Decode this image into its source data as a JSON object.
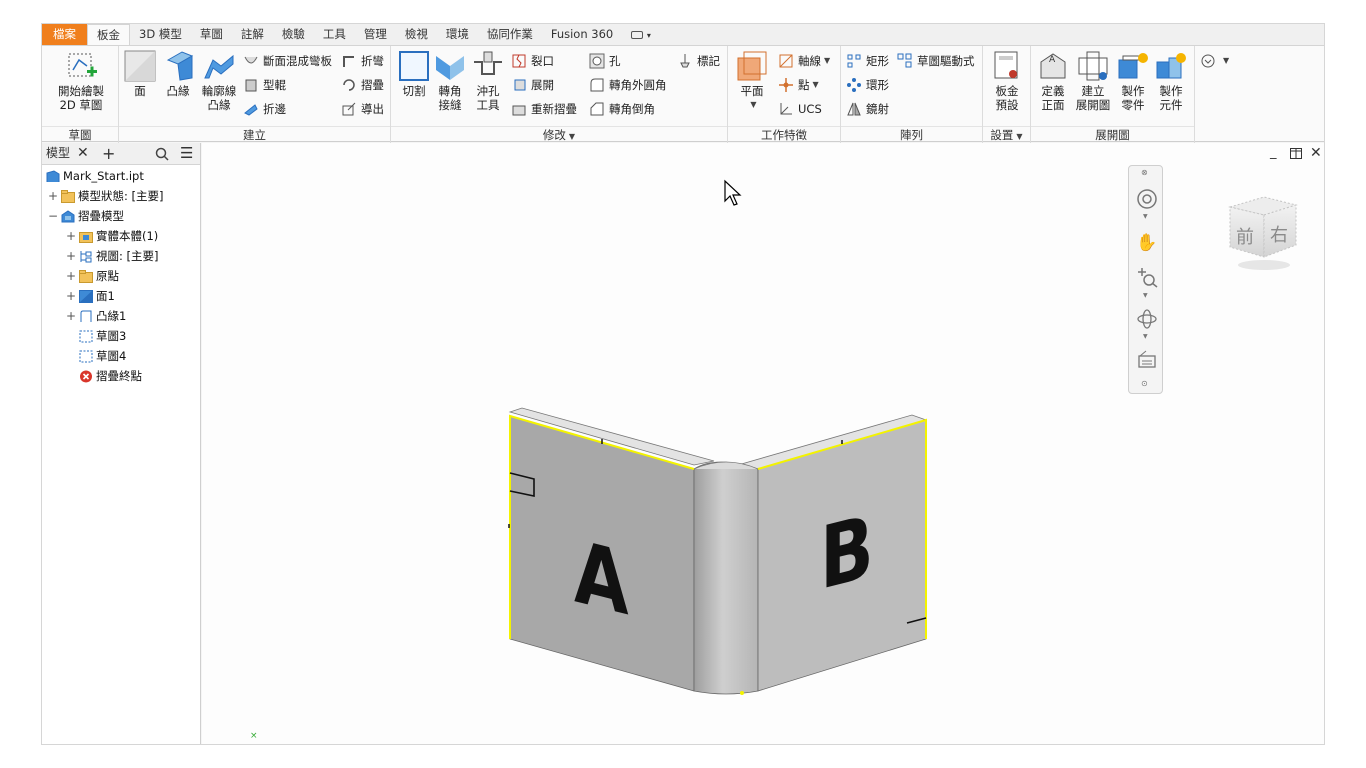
{
  "tabs": [
    "檔案",
    "板金",
    "3D 模型",
    "草圖",
    "註解",
    "檢驗",
    "工具",
    "管理",
    "檢視",
    "環境",
    "協同作業",
    "Fusion 360"
  ],
  "active_tab": "板金",
  "tab_extra_caret": "▾",
  "ribbon": {
    "sketch_panel": {
      "title": "草圖",
      "start_sketch": "開始繪製\n2D 草圖"
    },
    "create_panel": {
      "title": "建立",
      "face": "面",
      "flange": "凸緣",
      "contour_flange": "輪廓線\n凸緣",
      "lofted_flange": "斷面混成彎板",
      "contour_roll": "型輥",
      "hem": "折邊",
      "fold": "折彎",
      "unfold_ref": "摺疊",
      "export": "導出"
    },
    "modify_panel": {
      "title": "修改",
      "cut": "切割",
      "corner_seam": "轉角\n接縫",
      "punch_tool": "沖孔\n工具",
      "rip": "裂口",
      "unfold": "展開",
      "refold": "重新摺疊",
      "hole": "孔",
      "corner_round": "轉角外圓角",
      "corner_chamfer": "轉角倒角",
      "mark": "標記"
    },
    "work_features_panel": {
      "title": "工作特徵",
      "plane": "平面",
      "axis": "軸線",
      "point": "點",
      "ucs": "UCS"
    },
    "pattern_panel": {
      "title": "陣列",
      "rectangular": "矩形",
      "circular": "環形",
      "mirror": "鏡射",
      "sketch_driven": "草圖驅動式"
    },
    "setup_panel": {
      "title": "設置",
      "sheet_metal_defaults": "板金\n預設"
    },
    "flat_pattern_panel": {
      "title": "展開圖",
      "define_a_side": "定義\n正面",
      "create_flat_pattern": "建立\n展開圖",
      "make_part": "製作\n零件",
      "make_components": "製作\n元件"
    }
  },
  "browser": {
    "tab_label": "模型",
    "tree": [
      {
        "label": "Mark_Start.ipt",
        "level": 0,
        "expander": "",
        "icon": "part-icon"
      },
      {
        "label": "模型狀態: [主要]",
        "level": 1,
        "expander": "+",
        "icon": "folder-icon"
      },
      {
        "label": "摺疊模型",
        "level": 1,
        "expander": "−",
        "icon": "folded-model-icon"
      },
      {
        "label": "實體本體(1)",
        "level": 2,
        "expander": "+",
        "icon": "solid-bodies-icon"
      },
      {
        "label": "視圖: [主要]",
        "level": 2,
        "expander": "+",
        "icon": "view-icon"
      },
      {
        "label": "原點",
        "level": 2,
        "expander": "+",
        "icon": "folder-icon"
      },
      {
        "label": "面1",
        "level": 2,
        "expander": "+",
        "icon": "face-icon"
      },
      {
        "label": "凸緣1",
        "level": 2,
        "expander": "+",
        "icon": "flange-icon"
      },
      {
        "label": "草圖3",
        "level": 2,
        "expander": "",
        "icon": "sketch-icon"
      },
      {
        "label": "草圖4",
        "level": 2,
        "expander": "",
        "icon": "sketch-icon"
      },
      {
        "label": "摺疊終點",
        "level": 2,
        "expander": "",
        "icon": "end-of-folded-icon"
      }
    ]
  },
  "viewcube": {
    "front": "前",
    "right": "右"
  },
  "model": {
    "face_a_text": "A",
    "face_b_text": "B"
  },
  "colors": {
    "file_tab": "#f07f1d",
    "selection_edge": "#f3f300",
    "part_face": "#bdbdbd",
    "part_face_dark": "#a9a9a9"
  }
}
